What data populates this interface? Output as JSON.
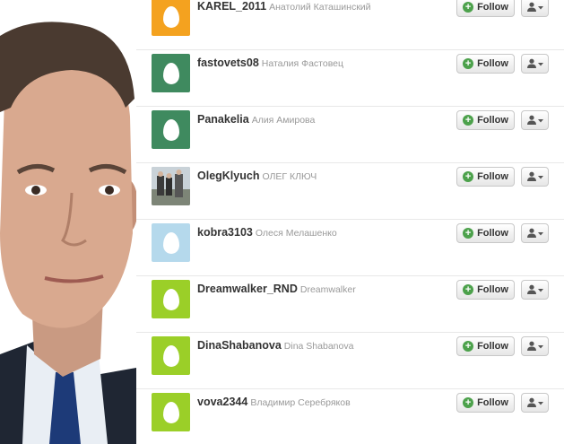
{
  "users": [
    {
      "screen_name": "KAREL_2011",
      "full_name": "Анатолий Каташинский",
      "avatar": "egg",
      "avatar_color": "#f4a21f"
    },
    {
      "screen_name": "fastovets08",
      "full_name": "Наталия Фастовец",
      "avatar": "egg",
      "avatar_color": "#3f8a5f"
    },
    {
      "screen_name": "Panakelia",
      "full_name": "Алия Амирова",
      "avatar": "egg",
      "avatar_color": "#3f8a5f"
    },
    {
      "screen_name": "OlegKlyuch",
      "full_name": "ОЛЕГ КЛЮЧ",
      "avatar": "photo",
      "avatar_color": "#8f9aa0"
    },
    {
      "screen_name": "kobra3103",
      "full_name": "Олеся Мелашенко",
      "avatar": "egg",
      "avatar_color": "#b5d9ec"
    },
    {
      "screen_name": "Dreamwalker_RND",
      "full_name": "Dreamwalker",
      "avatar": "egg",
      "avatar_color": "#9bcf28"
    },
    {
      "screen_name": "DinaShabanova",
      "full_name": "Dina Shabanova",
      "avatar": "egg",
      "avatar_color": "#9bcf28"
    },
    {
      "screen_name": "vova2344",
      "full_name": "Владимир Серебряков",
      "avatar": "egg",
      "avatar_color": "#9bcf28"
    }
  ],
  "follow_label": "Follow",
  "icons": {
    "follow": "plus-circle-icon",
    "user_menu": "user-dropdown-icon"
  },
  "colors": {
    "follow_plus": "#4ca14b",
    "screen_name": "#333333",
    "full_name": "#999999",
    "divider": "#e8e8e8"
  }
}
